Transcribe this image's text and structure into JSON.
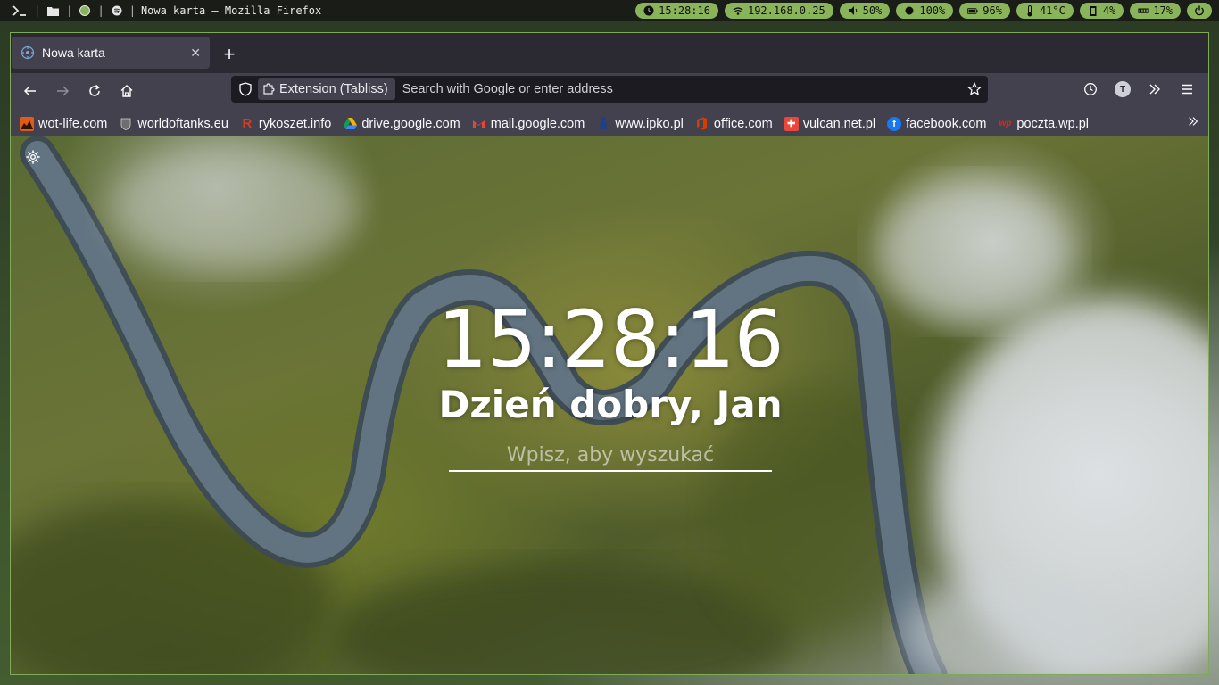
{
  "topbar": {
    "workspaces": [
      "terminal-icon",
      "folder-icon",
      "globe-icon",
      "spotify-icon"
    ],
    "window_title": "Nowa karta — Mozilla Firefox",
    "status": {
      "clock": "15:28:16",
      "ip": "192.168.0.25",
      "volume": "50%",
      "brightness": "100%",
      "battery": "96%",
      "temperature": "41°C",
      "cpu": "4%",
      "memory": "17%"
    },
    "accent_color": "#8ab45a"
  },
  "browser": {
    "tab": {
      "label": "Nowa karta"
    },
    "urlbar": {
      "extension_chip": "Extension (Tabliss)",
      "placeholder": "Search with Google or enter address"
    },
    "toolbar_avatar_letter": "T",
    "bookmarks": [
      {
        "label": "wot-life.com",
        "icon": "wot-life-icon",
        "color": "#e05a1a"
      },
      {
        "label": "worldoftanks.eu",
        "icon": "wot-icon",
        "color": "#888888"
      },
      {
        "label": "rykoszet.info",
        "icon": "rykoszet-icon",
        "color": "#d83a1e"
      },
      {
        "label": "drive.google.com",
        "icon": "google-drive-icon",
        "color": "#f4b400"
      },
      {
        "label": "mail.google.com",
        "icon": "gmail-icon",
        "color": "#ea4335"
      },
      {
        "label": "www.ipko.pl",
        "icon": "ipko-icon",
        "color": "#1e3f8a"
      },
      {
        "label": "office.com",
        "icon": "office-icon",
        "color": "#d83b01"
      },
      {
        "label": "vulcan.net.pl",
        "icon": "vulcan-icon",
        "color": "#e8473a"
      },
      {
        "label": "facebook.com",
        "icon": "facebook-icon",
        "color": "#1877f2"
      },
      {
        "label": "poczta.wp.pl",
        "icon": "wp-icon",
        "color": "#e1261c"
      }
    ]
  },
  "newtab": {
    "clock": "15:28:16",
    "greeting": "Dzień dobry, Jan",
    "search_placeholder": "Wpisz, aby wyszukać"
  }
}
